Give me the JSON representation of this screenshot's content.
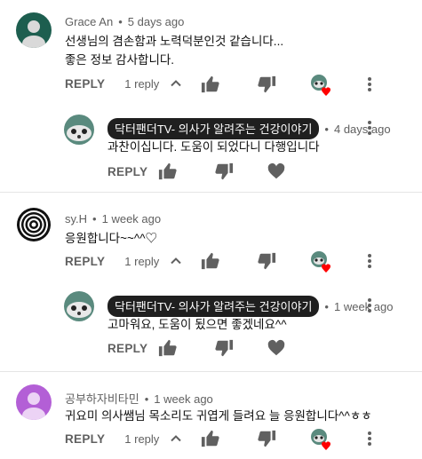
{
  "comments": [
    {
      "author": "Grace An",
      "time": "5 days ago",
      "lines": [
        "선생님의 겸손함과 노력덕분인것 같습니다...",
        "좋은 정보 감사합니다."
      ],
      "reply_label": "REPLY",
      "reply_count": "1 reply",
      "reply": {
        "author": "닥터팬더TV- 의사가 알려주는 건강이야기",
        "time": "4 days ago",
        "text": "과찬이십니다. 도움이 되었다니 다행입니다",
        "reply_label": "REPLY"
      }
    },
    {
      "author": "sy.H",
      "time": "1 week ago",
      "lines": [
        "응원합니다~~^^♡"
      ],
      "reply_label": "REPLY",
      "reply_count": "1 reply",
      "reply": {
        "author": "닥터팬더TV- 의사가 알려주는 건강이야기",
        "time": "1 week ago",
        "text": "고마워요, 도움이 됬으면 좋겠네요^^",
        "reply_label": "REPLY"
      }
    },
    {
      "author": "공부하자비타민",
      "time": "1 week ago",
      "lines": [
        "귀요미 의사쌤님 목소리도 귀엽게 들려요 늘 응원합니다^^ㅎㅎ"
      ],
      "reply_label": "REPLY",
      "reply_count": "1 reply"
    }
  ],
  "separator": "•",
  "colors": {
    "heart_red": "#ff0000",
    "grace_avatar": "#1d5e4f",
    "vitamin_avatar": "#b35fd6"
  },
  "icons": [
    "thumb-up-icon",
    "thumb-down-icon",
    "heart-icon",
    "chevron-up-icon",
    "more-vert-icon",
    "creator-heart-badge-icon"
  ]
}
